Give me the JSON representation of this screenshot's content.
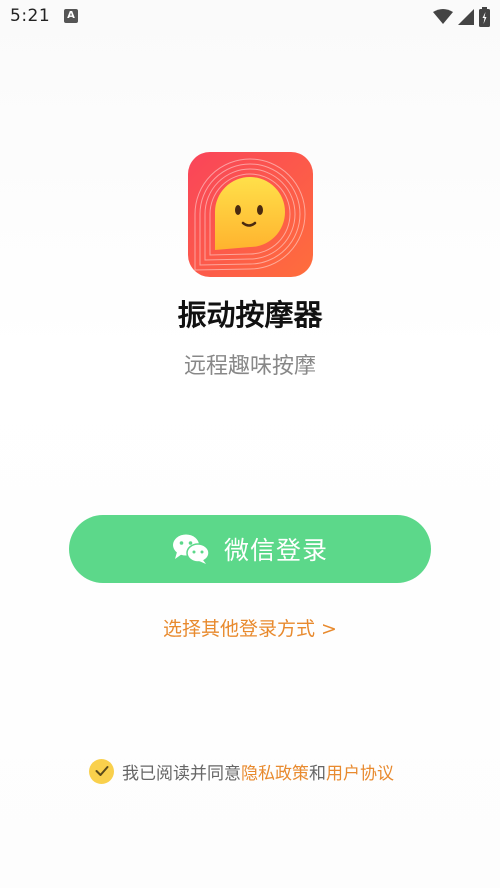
{
  "status_bar": {
    "time": "5:21",
    "notification_icon": "A"
  },
  "app": {
    "name": "振动按摩器",
    "slogan": "远程趣味按摩"
  },
  "login": {
    "wechat_label": "微信登录",
    "other_methods_label": "选择其他登录方式 >"
  },
  "agreement": {
    "prefix": "我已阅读并同意",
    "privacy_link": "隐私政策",
    "conjunction": "和",
    "terms_link": "用户协议"
  },
  "colors": {
    "wechat_green": "#5cd88a",
    "link_orange": "#e88a2e",
    "check_yellow": "#f9d04c"
  },
  "icons": {
    "wechat": "wechat-icon",
    "check": "check-icon",
    "wifi": "wifi-icon",
    "signal": "signal-icon",
    "battery": "battery-icon"
  }
}
